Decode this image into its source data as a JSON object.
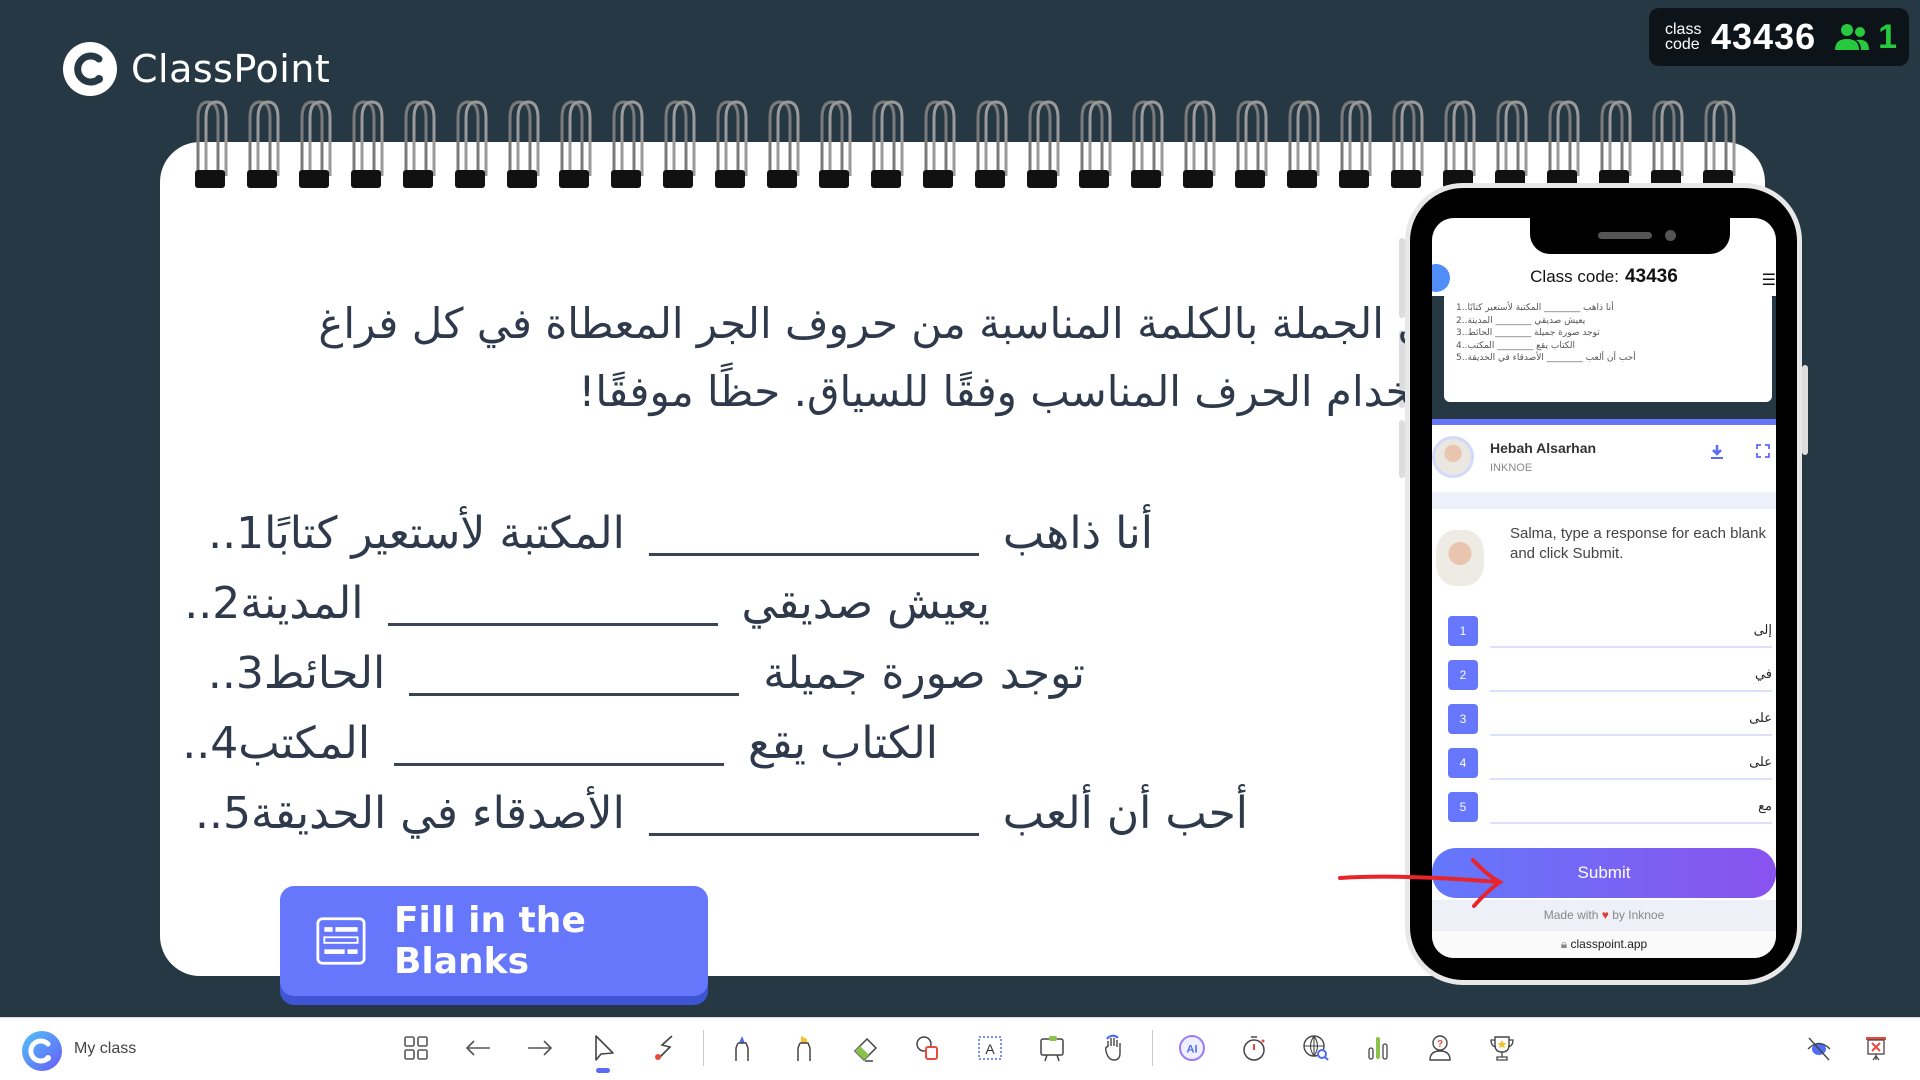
{
  "app": {
    "brand": "ClassPoint"
  },
  "class_badge": {
    "label": "class code",
    "code": "43436",
    "participants": "1",
    "participants_color": "#27c93f"
  },
  "slide": {
    "instruction_line1": "أكمل الجملة بالكلمة المناسبة من حروف الجر المعطاة في كل فراغ",
    "instruction_line2": "تأكد من استخدام الحرف المناسب وفقًا للسياق. حظًا موفقًا!",
    "questions": [
      {
        "num": "1..",
        "before": "أنا ذاهب",
        "after": "المكتبة لأستعير كتابًا"
      },
      {
        "num": "2..",
        "before": "يعيش صديقي",
        "after": "المدينة"
      },
      {
        "num": "3..",
        "before": "توجد صورة جميلة",
        "after": "الحائط"
      },
      {
        "num": "4..",
        "before": "الكتاب يقع",
        "after": "المكتب"
      },
      {
        "num": "5..",
        "before": "أحب أن ألعب",
        "after": "الأصدقاء في الحديقة"
      }
    ],
    "activity_button": "Fill in the Blanks",
    "accent_color": "#6677fc"
  },
  "phone": {
    "class_code_label": "Class code:",
    "class_code": "43436",
    "slide_preview": [
      "أنا ذاهب ________ المكتبة لأستعير كتابًا..1",
      "يعيش صديقي ________ المدينة..2",
      "توجد صورة جميلة ________ الحائط..3",
      "الكتاب يقع ________ المكتب..4",
      "أحب أن ألعب ________ الأصدقاء في الحديقة..5"
    ],
    "teacher_name": "Hebah Alsarhan",
    "teacher_org": "INKNOE",
    "prompt": "Salma, type a response for each blank and click Submit.",
    "answers": [
      {
        "num": "1",
        "value": "إلى"
      },
      {
        "num": "2",
        "value": "في"
      },
      {
        "num": "3",
        "value": "على"
      },
      {
        "num": "4",
        "value": "على"
      },
      {
        "num": "5",
        "value": "مع"
      }
    ],
    "submit_label": "Submit",
    "footer_made_with": "Made with",
    "footer_by": "by Inknoe",
    "url": "classpoint.app"
  },
  "toolbar": {
    "class_name": "My class",
    "tools": [
      "slides-grid",
      "previous",
      "next",
      "pointer",
      "laser-pen",
      "pen",
      "highlighter",
      "eraser",
      "shapes",
      "text-box",
      "whiteboard",
      "drag-objects",
      "ai",
      "timer",
      "embedded-browser",
      "quick-poll",
      "name-picker",
      "award-stars",
      "hide-ink",
      "end-show"
    ]
  }
}
